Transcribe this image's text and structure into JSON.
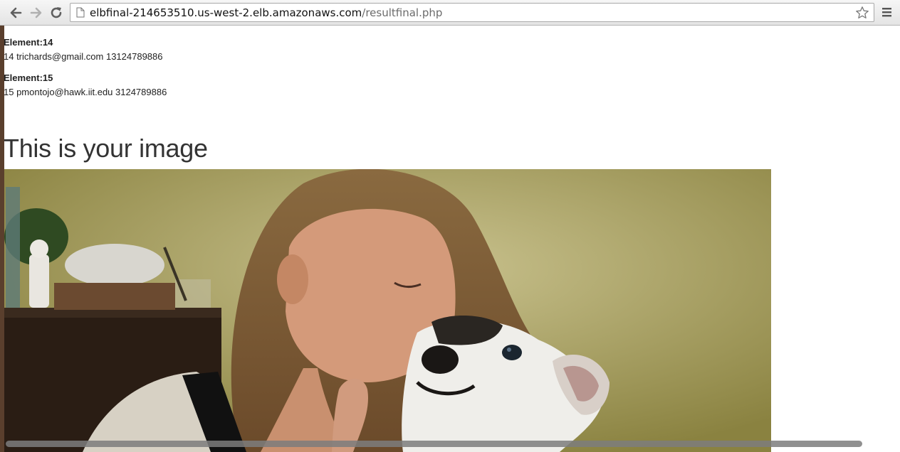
{
  "browser": {
    "url_host": "elbfinal-214653510.us-west-2.elb.amazonaws.com",
    "url_path": "/resultfinal.php"
  },
  "entries": [
    {
      "label": "Element:14",
      "value": "14 trichards@gmail.com 13124789886"
    },
    {
      "label": "Element:15",
      "value": "15 pmontojo@hawk.iit.edu 3124789886"
    }
  ],
  "heading": "This is your image",
  "image": {
    "subject": "woman-kissing-dog-photo"
  }
}
